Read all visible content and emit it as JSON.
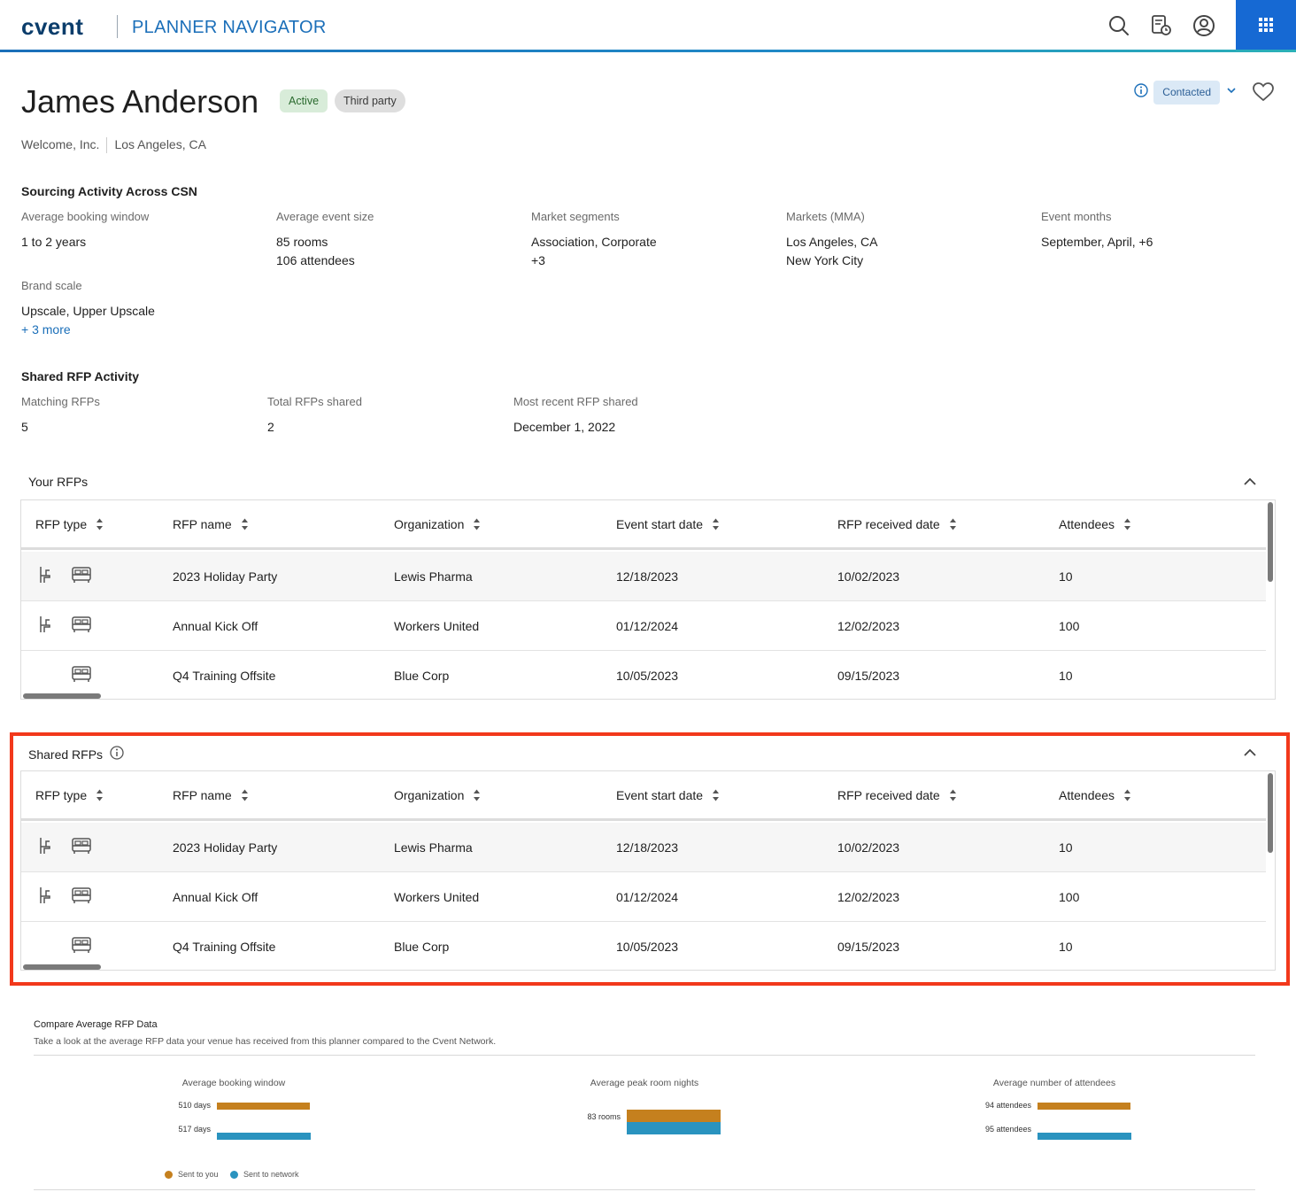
{
  "header": {
    "logo": "cvent",
    "app_title": "PLANNER NAVIGATOR",
    "icons": [
      "search-icon",
      "document-clock-icon",
      "user-circle-icon",
      "apps-grid-icon"
    ]
  },
  "profile": {
    "name": "James Anderson",
    "badges": [
      "Active",
      "Third party"
    ],
    "company": "Welcome, Inc.",
    "location": "Los Angeles, CA",
    "status": "Contacted"
  },
  "sourcing": {
    "title": "Sourcing Activity Across CSN",
    "fields": [
      {
        "label": "Average booking window",
        "lines": [
          "1 to 2 years"
        ]
      },
      {
        "label": "Average event size",
        "lines": [
          "85 rooms",
          "106 attendees"
        ]
      },
      {
        "label": "Market segments",
        "lines": [
          "Association, Corporate",
          "+3"
        ]
      },
      {
        "label": "Markets (MMA)",
        "lines": [
          "Los Angeles, CA",
          "New York City"
        ]
      },
      {
        "label": "Event months",
        "lines": [
          "September, April, +6"
        ]
      }
    ],
    "brand_scale": {
      "label": "Brand scale",
      "value": "Upscale, Upper Upscale",
      "more": "+ 3 more"
    }
  },
  "shared_activity": {
    "title": "Shared RFP Activity",
    "fields": [
      {
        "label": "Matching RFPs",
        "value": "5"
      },
      {
        "label": "Total RFPs shared",
        "value": "2"
      },
      {
        "label": "Most recent RFP shared",
        "value": "December 1, 2022"
      }
    ]
  },
  "your_rfps": {
    "title": "Your RFPs",
    "columns": [
      "RFP type",
      "RFP name",
      "Organization",
      "Event start date",
      "RFP received date",
      "Attendees"
    ],
    "rows": [
      {
        "name": "2023 Holiday Party",
        "org": "Lewis Pharma",
        "start": "12/18/2023",
        "received": "10/02/2023",
        "attendees": "10"
      },
      {
        "name": "Annual Kick Off",
        "org": "Workers United",
        "start": "01/12/2024",
        "received": "12/02/2023",
        "attendees": "100"
      },
      {
        "name": "Q4 Training Offsite",
        "org": "Blue Corp",
        "start": "10/05/2023",
        "received": "09/15/2023",
        "attendees": "10"
      }
    ]
  },
  "shared_rfps": {
    "title": "Shared RFPs",
    "columns": [
      "RFP type",
      "RFP name",
      "Organization",
      "Event start date",
      "RFP received date",
      "Attendees"
    ],
    "rows": [
      {
        "name": "2023 Holiday Party",
        "org": "Lewis Pharma",
        "start": "12/18/2023",
        "received": "10/02/2023",
        "attendees": "10"
      },
      {
        "name": "Annual Kick Off",
        "org": "Workers United",
        "start": "01/12/2024",
        "received": "12/02/2023",
        "attendees": "100"
      },
      {
        "name": "Q4 Training Offsite",
        "org": "Blue Corp",
        "start": "10/05/2023",
        "received": "09/15/2023",
        "attendees": "10"
      }
    ]
  },
  "compare": {
    "title": "Compare Average RFP Data",
    "subtitle": "Take a look at the average RFP data your venue has received from this planner compared to the Cvent Network.",
    "colors": {
      "sent_to_you": "#c5801e",
      "sent_to_network": "#2a93bf"
    },
    "legend": [
      "Sent to you",
      "Sent to network"
    ]
  },
  "chart_data": [
    {
      "type": "bar",
      "title": "Average booking window",
      "series": [
        {
          "name": "Sent to you",
          "values": [
            510
          ]
        },
        {
          "name": "Sent to network",
          "values": [
            517
          ]
        }
      ],
      "labels": [
        "510 days",
        "517 days"
      ]
    },
    {
      "type": "bar",
      "title": "Average peak room nights",
      "series": [
        {
          "name": "Sent to you",
          "values": [
            83
          ]
        },
        {
          "name": "Sent to network",
          "values": [
            83
          ]
        }
      ],
      "labels": [
        "83 rooms"
      ]
    },
    {
      "type": "bar",
      "title": "Average number of attendees",
      "series": [
        {
          "name": "Sent to you",
          "values": [
            94
          ]
        },
        {
          "name": "Sent to network",
          "values": [
            95
          ]
        }
      ],
      "labels": [
        "94 attendees",
        "95 attendees"
      ]
    }
  ]
}
